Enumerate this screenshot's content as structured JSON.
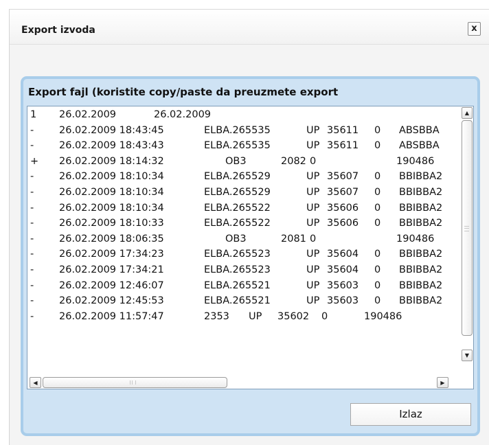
{
  "window": {
    "title": "Export izvoda",
    "close_label": "x"
  },
  "panel": {
    "title": "Export fajl (koristite copy/paste da preuzmete export"
  },
  "export_lines": [
    {
      "c": [
        "1",
        "26.02.2009",
        "26.02.2009",
        "",
        "",
        "",
        ""
      ]
    },
    {
      "c": [
        "-",
        "26.02.2009 18:43:45",
        "ELBA.265535",
        "UP",
        "35611",
        "0",
        "ABSBBA"
      ]
    },
    {
      "c": [
        "-",
        "26.02.2009 18:43:43",
        "ELBA.265535",
        "UP",
        "35611",
        "0",
        "ABSBBA"
      ]
    },
    {
      "c": [
        "+",
        "26.02.2009 18:14:32",
        "OB3",
        "2082",
        "0",
        "190486",
        ""
      ]
    },
    {
      "c": [
        "-",
        "26.02.2009 18:10:34",
        "ELBA.265529",
        "UP",
        "35607",
        "0",
        "BBIBBA2"
      ]
    },
    {
      "c": [
        "-",
        "26.02.2009 18:10:34",
        "ELBA.265529",
        "UP",
        "35607",
        "0",
        "BBIBBA2"
      ]
    },
    {
      "c": [
        "-",
        "26.02.2009 18:10:34",
        "ELBA.265522",
        "UP",
        "35606",
        "0",
        "BBIBBA2"
      ]
    },
    {
      "c": [
        "-",
        "26.02.2009 18:10:33",
        "ELBA.265522",
        "UP",
        "35606",
        "0",
        "BBIBBA2"
      ]
    },
    {
      "c": [
        "-",
        "26.02.2009 18:06:35",
        "OB3",
        "2081",
        "0",
        "190486",
        ""
      ]
    },
    {
      "c": [
        "-",
        "26.02.2009 17:34:23",
        "ELBA.265523",
        "UP",
        "35604",
        "0",
        "BBIBBA2"
      ]
    },
    {
      "c": [
        "-",
        "26.02.2009 17:34:21",
        "ELBA.265523",
        "UP",
        "35604",
        "0",
        "BBIBBA2"
      ]
    },
    {
      "c": [
        "-",
        "26.02.2009 12:46:07",
        "ELBA.265521",
        "UP",
        "35603",
        "0",
        "BBIBBA2"
      ]
    },
    {
      "c": [
        "-",
        "26.02.2009 12:45:53",
        "ELBA.265521",
        "UP",
        "35603",
        "0",
        "BBIBBA2"
      ]
    },
    {
      "c": [
        "-",
        "26.02.2009 11:57:47",
        "2353",
        "UP",
        "35602",
        "0",
        "190486"
      ]
    }
  ],
  "scrollbars": {
    "up_icon": "arrow-up-icon",
    "down_icon": "arrow-down-icon",
    "left_icon": "arrow-left-icon",
    "right_icon": "arrow-right-icon"
  },
  "buttons": {
    "exit_label": "Izlaz"
  },
  "colors": {
    "panel_bg": "#cfe3f4",
    "panel_border": "#a9cdea"
  }
}
